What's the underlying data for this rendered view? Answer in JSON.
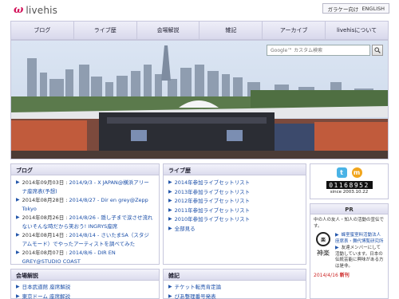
{
  "header": {
    "logo_mark": "ω",
    "logo_text": "livehis",
    "lang_mobile": "ガラケー向け",
    "lang_english": "ENGLISH"
  },
  "nav": {
    "items": [
      {
        "label": "ブログ"
      },
      {
        "label": "ライブ歴"
      },
      {
        "label": "会場解説"
      },
      {
        "label": "雑記"
      },
      {
        "label": "アーカイブ"
      },
      {
        "label": "livehisについて"
      }
    ]
  },
  "search": {
    "placeholder": "Google™ カスタム検索"
  },
  "blog": {
    "title": "ブログ",
    "entries": [
      {
        "date": "2014年09月03日 :",
        "link": "2014/9/3 - X JAPAN@横浜アリーナ座席表(予想)"
      },
      {
        "date": "2014年08月28日 :",
        "link": "2014/8/27 - Dir en grey@Zepp Tokyo"
      },
      {
        "date": "2014年08月26日 :",
        "link": "2014/8/26 - 隠し子まで涙させ流れないそんな時だから笑おう! INGRYS座席"
      },
      {
        "date": "2014年08月14日 :",
        "link": "2014/8/14 - さいたまSA（スタジアムモード）でやったアーティストを調べてみた"
      },
      {
        "date": "2014年08月07日 :",
        "link": "2014/8/6 - DIR EN GREY@STUDIO COAST"
      }
    ]
  },
  "live_history": {
    "title": "ライブ歴",
    "items": [
      {
        "label": "2014年参加ライブセットリスト"
      },
      {
        "label": "2013年参加ライブセットリスト"
      },
      {
        "label": "2012年参加ライブセットリスト"
      },
      {
        "label": "2011年参加ライブセットリスト"
      },
      {
        "label": "2010年参加ライブセットリスト"
      },
      {
        "label": "全部見る"
      }
    ]
  },
  "venues": {
    "title": "会場解説",
    "items": [
      {
        "label": "日本武道館 座席解説"
      },
      {
        "label": "東京ドーム 座席解説"
      }
    ]
  },
  "misc": {
    "title": "雑記",
    "items": [
      {
        "label": "チケット転売肯定論"
      },
      {
        "label": "ぴあ整理番号発表"
      }
    ]
  },
  "side_widget": {
    "twitter_label": "t",
    "mixi_label": "m",
    "counter": "01168952",
    "since": "since 2003.10.22"
  },
  "pr": {
    "title": "PR",
    "intro": "中の人の友人・知人の活動の宣伝です。",
    "logo_text": "神楽",
    "circle_text": "楽",
    "items": [
      {
        "label": "蜂室蜜室料活動法人 座席表・舞代博覧研究所"
      },
      {
        "label": "友達メンバーにして活動しています。日本の伝統芸能に興味がある方は是非。"
      }
    ],
    "new_date": "2014/4/16",
    "new_label": "新刊"
  },
  "colors": {
    "accent": "#d4135a",
    "link": "#1a4ea8",
    "nav_bg": "#dcdcee"
  }
}
